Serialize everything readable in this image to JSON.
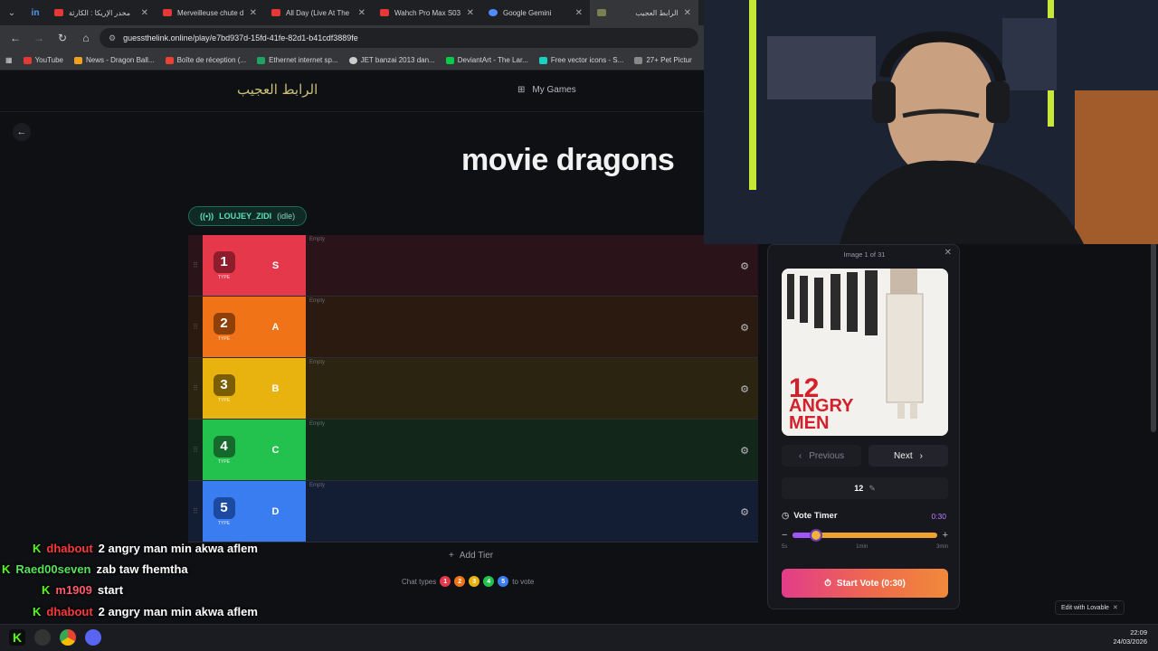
{
  "browser": {
    "tabs": [
      {
        "title": "مخدر الإريكا : الكارثة",
        "color": "#e53935"
      },
      {
        "title": "Merveilleuse chute d",
        "color": "#e53935"
      },
      {
        "title": "All Day (Live At The",
        "color": "#e53935"
      },
      {
        "title": "Wahch Pro Max S03",
        "color": "#e53935"
      },
      {
        "title": "Google Gemini",
        "color": "#4f8cff"
      },
      {
        "title": "الرابط العجيب",
        "color": "#7a7f4f"
      }
    ],
    "url": "guessthelink.online/play/e7bd937d-15fd-41fe-82d1-b41cdf3889fe",
    "bookmarks": [
      {
        "label": "YouTube",
        "color": "#e53935"
      },
      {
        "label": "News - Dragon Ball...",
        "color": "#f0a020"
      },
      {
        "label": "Boîte de réception (...",
        "color": "#ea4335"
      },
      {
        "label": "Ethernet internet sp...",
        "color": "#1ea362"
      },
      {
        "label": "JET banzai 2013 dan...",
        "color": "#cccccc"
      },
      {
        "label": "DeviantArt - The Lar...",
        "color": "#05cc47"
      },
      {
        "label": "Free vector icons - S...",
        "color": "#18d1c0"
      },
      {
        "label": "27+ Pet Pictur",
        "color": "#888888"
      }
    ]
  },
  "app": {
    "logo": "الرابط العجيب",
    "nav_my_games": "My Games",
    "game_title": "movie dragons",
    "user": {
      "name": "LOUJEY_ZIDI",
      "status": "(idle)"
    },
    "tiers": [
      {
        "num": "1",
        "type": "TYPE",
        "letter": "S",
        "empty": "Empty",
        "color": "#e5384b",
        "numColor": "#8d1d2a",
        "bg": "#2a1319"
      },
      {
        "num": "2",
        "type": "TYPE",
        "letter": "A",
        "empty": "Empty",
        "color": "#f07317",
        "numColor": "#8f3f08",
        "bg": "#2a1a10"
      },
      {
        "num": "3",
        "type": "TYPE",
        "letter": "B",
        "empty": "Empty",
        "color": "#e8b30e",
        "numColor": "#7a5d05",
        "bg": "#2a2410"
      },
      {
        "num": "4",
        "type": "TYPE",
        "letter": "C",
        "empty": "Empty",
        "color": "#23c14e",
        "numColor": "#14692b",
        "bg": "#12261a"
      },
      {
        "num": "5",
        "type": "TYPE",
        "letter": "D",
        "empty": "Empty",
        "color": "#3a7df0",
        "numColor": "#1c4aa0",
        "bg": "#131d33"
      }
    ],
    "add_tier": "Add Tier",
    "chat_types_label": "Chat types",
    "chat_types_suffix": "to vote",
    "chat_type_numbers": [
      "1",
      "2",
      "3",
      "4",
      "5"
    ]
  },
  "panel": {
    "image_count": "Image 1 of 31",
    "poster_text_line1": "12",
    "poster_text_line2": "ANGRY",
    "poster_text_line3": "MEN",
    "prev_label": "Previous",
    "next_label": "Next",
    "answer_text": "12",
    "vote_timer_label": "Vote Timer",
    "vote_timer_value": "0:30",
    "slider_fraction": 0.16,
    "tick_min": "5s",
    "tick_mid": "1min",
    "tick_max": "3min",
    "start_vote_label": "Start Vote (0:30)"
  },
  "lovable_badge": "Edit with  Lovable",
  "chat": [
    {
      "user": "dhabout",
      "msg": "2 angry man min akwa aflem",
      "userColor": "#ff3b3b"
    },
    {
      "user": "Raed00seven",
      "msg": "zab taw fhemtha",
      "userColor": "#56e35a"
    },
    {
      "user": "m1909",
      "msg": "start",
      "userColor": "#ff5a6a"
    },
    {
      "user": "dhabout",
      "msg": "2 angry man min akwa aflem",
      "userColor": "#ff3b3b"
    }
  ],
  "clock": {
    "time": "22:09",
    "date": "24/03/2026"
  }
}
